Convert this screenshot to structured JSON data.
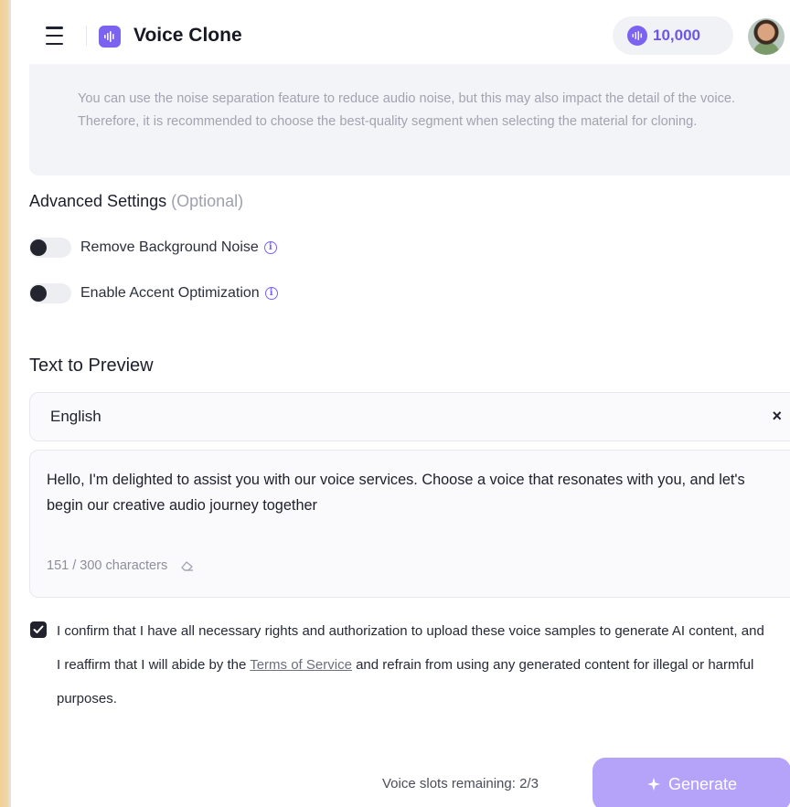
{
  "header": {
    "app_title": "Voice Clone",
    "credits": "10,000",
    "menu_icon": "hamburger-menu-icon",
    "logo_icon": "waveform-icon",
    "credit_icon": "waveform-coin-icon",
    "accent_color": "#7b62f0"
  },
  "notice": {
    "text": "You can use the noise separation feature to reduce audio noise, but this may also impact the detail of the voice. Therefore, it is recommended to choose the best-quality segment when selecting the material for cloning."
  },
  "advanced": {
    "title": "Advanced Settings",
    "optional_label": "(Optional)",
    "options": [
      {
        "label": "Remove Background Noise",
        "enabled": false
      },
      {
        "label": "Enable Accent Optimization",
        "enabled": false
      }
    ]
  },
  "preview": {
    "title": "Text to Preview",
    "language": "English",
    "clear_symbol": "×",
    "text": "Hello, I'm delighted to assist you with our voice services. Choose a voice that resonates with you, and let's begin our creative audio journey together",
    "char_count": "151 / 300 characters"
  },
  "consent": {
    "checked": true,
    "text_before": "I confirm that I have all necessary rights and authorization to upload these voice samples to generate AI content, and I reaffirm that I will abide by the ",
    "link_text": "Terms of Service",
    "text_after": " and refrain from using any generated content for illegal or harmful purposes."
  },
  "footer": {
    "slots_text": "Voice slots remaining: 2/3",
    "generate_label": "Generate",
    "generate_color": "#b4a3f8"
  }
}
